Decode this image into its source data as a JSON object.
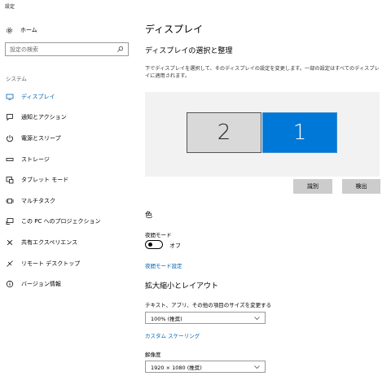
{
  "window": {
    "title": "設定"
  },
  "sidebar": {
    "home_label": "ホーム",
    "search_placeholder": "設定の検索",
    "section_label": "システム",
    "items": [
      {
        "label": "ディスプレイ",
        "icon": "monitor-icon",
        "active": true
      },
      {
        "label": "通知とアクション",
        "icon": "notification-icon",
        "active": false
      },
      {
        "label": "電源とスリープ",
        "icon": "power-icon",
        "active": false
      },
      {
        "label": "ストレージ",
        "icon": "storage-icon",
        "active": false
      },
      {
        "label": "タブレット モード",
        "icon": "tablet-icon",
        "active": false
      },
      {
        "label": "マルチタスク",
        "icon": "multitask-icon",
        "active": false
      },
      {
        "label": "この PC へのプロジェクション",
        "icon": "projection-icon",
        "active": false
      },
      {
        "label": "共有エクスペリエンス",
        "icon": "shared-experience-icon",
        "active": false
      },
      {
        "label": "リモート デスクトップ",
        "icon": "remote-desktop-icon",
        "active": false
      },
      {
        "label": "バージョン情報",
        "icon": "info-icon",
        "active": false
      }
    ]
  },
  "main": {
    "title": "ディスプレイ",
    "subtitle": "ディスプレイの選択と整理",
    "description": "下でディスプレイを選択して、そのディスプレイの設定を変更します。一部の設定はすべてのディスプレイに適用されます。",
    "monitors": [
      {
        "label": "2",
        "selected": false
      },
      {
        "label": "1",
        "selected": true
      }
    ],
    "identify_button": "識別",
    "detect_button": "検出",
    "color_heading": "色",
    "night_mode_label": "夜間モード",
    "night_mode_state": "オフ",
    "night_mode_settings_link": "夜間モード設定",
    "scale_heading": "拡大縮小とレイアウト",
    "text_size_label": "テキスト、アプリ、その他の項目のサイズを変更する",
    "scale_value": "100% (推奨)",
    "custom_scaling_link": "カスタム スケーリング",
    "resolution_label": "解像度",
    "resolution_value": "1920 × 1080 (推奨)"
  },
  "colors": {
    "accent": "#0078d7",
    "link": "#0063b1",
    "arrange_bg": "#f2f2f2",
    "button_bg": "#cccccc"
  }
}
